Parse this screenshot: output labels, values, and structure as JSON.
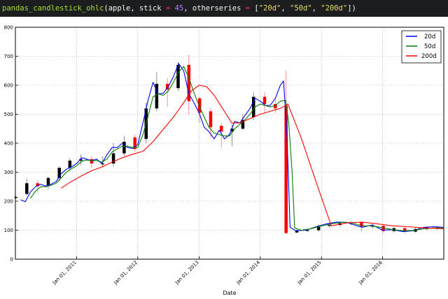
{
  "code": {
    "fn": "pandas_candlestick_ohlc",
    "open": "(",
    "arg1": "apple, stick ",
    "eq1": "=",
    "sp1": " ",
    "stick": "45",
    "sep1": ", otherseries ",
    "eq2": "=",
    "lb": " [",
    "s1": "\"20d\"",
    "c1": ", ",
    "s2": "\"50d\"",
    "c2": ", ",
    "s3": "\"200d\"",
    "close": "])"
  },
  "chart_data": {
    "type": "line",
    "xlabel": "Date",
    "ylabel": "",
    "ylim": [
      0,
      800
    ],
    "xlim": [
      "2010-01-01",
      "2016-12-31"
    ],
    "yticks": [
      0,
      100,
      200,
      300,
      400,
      500,
      600,
      700,
      800
    ],
    "xticks": [
      {
        "date": "2011-01-01",
        "label": "Jan 01, 2011"
      },
      {
        "date": "2012-01-01",
        "label": "Jan 01, 2012"
      },
      {
        "date": "2013-01-01",
        "label": "Jan 01, 2013"
      },
      {
        "date": "2014-01-01",
        "label": "Jan 01, 2014"
      },
      {
        "date": "2015-01-01",
        "label": "Jan 01, 2015"
      },
      {
        "date": "2016-01-01",
        "label": "Jan 01, 2016"
      }
    ],
    "grid": true,
    "legend": "top-right",
    "candle_colors": {
      "up": "#000000",
      "down": "#ff0000"
    },
    "candles": [
      {
        "date": "2010-01-04",
        "open": 212,
        "high": 220,
        "low": 208,
        "close": 214
      },
      {
        "date": "2010-03-10",
        "open": 225,
        "high": 278,
        "low": 220,
        "close": 262
      },
      {
        "date": "2010-05-14",
        "open": 262,
        "high": 272,
        "low": 230,
        "close": 252
      },
      {
        "date": "2010-07-16",
        "open": 252,
        "high": 285,
        "low": 240,
        "close": 280
      },
      {
        "date": "2010-09-20",
        "open": 280,
        "high": 320,
        "low": 270,
        "close": 315
      },
      {
        "date": "2010-11-22",
        "open": 315,
        "high": 348,
        "low": 305,
        "close": 340
      },
      {
        "date": "2011-01-26",
        "open": 340,
        "high": 362,
        "low": 325,
        "close": 345
      },
      {
        "date": "2011-04-01",
        "open": 345,
        "high": 355,
        "low": 315,
        "close": 330
      },
      {
        "date": "2011-06-06",
        "open": 330,
        "high": 355,
        "low": 315,
        "close": 330
      },
      {
        "date": "2011-08-09",
        "open": 330,
        "high": 400,
        "low": 320,
        "close": 365
      },
      {
        "date": "2011-10-12",
        "open": 365,
        "high": 425,
        "low": 355,
        "close": 405
      },
      {
        "date": "2011-12-15",
        "open": 420,
        "high": 430,
        "low": 370,
        "close": 380
      },
      {
        "date": "2012-02-20",
        "open": 415,
        "high": 540,
        "low": 400,
        "close": 520
      },
      {
        "date": "2012-04-23",
        "open": 520,
        "high": 645,
        "low": 510,
        "close": 605
      },
      {
        "date": "2012-06-26",
        "open": 605,
        "high": 625,
        "low": 525,
        "close": 585
      },
      {
        "date": "2012-08-29",
        "open": 590,
        "high": 680,
        "low": 580,
        "close": 670
      },
      {
        "date": "2012-11-01",
        "open": 670,
        "high": 705,
        "low": 500,
        "close": 545
      },
      {
        "date": "2013-01-04",
        "open": 555,
        "high": 560,
        "low": 470,
        "close": 505
      },
      {
        "date": "2013-03-11",
        "open": 510,
        "high": 520,
        "low": 420,
        "close": 455
      },
      {
        "date": "2013-05-14",
        "open": 460,
        "high": 470,
        "low": 385,
        "close": 440
      },
      {
        "date": "2013-07-17",
        "open": 440,
        "high": 465,
        "low": 390,
        "close": 450
      },
      {
        "date": "2013-09-19",
        "open": 450,
        "high": 500,
        "low": 445,
        "close": 480
      },
      {
        "date": "2013-11-22",
        "open": 490,
        "high": 575,
        "low": 480,
        "close": 560
      },
      {
        "date": "2014-01-27",
        "open": 560,
        "high": 575,
        "low": 505,
        "close": 535
      },
      {
        "date": "2014-04-01",
        "open": 535,
        "high": 550,
        "low": 505,
        "close": 520
      },
      {
        "date": "2014-06-04",
        "open": 530,
        "high": 650,
        "low": 88,
        "close": 90
      },
      {
        "date": "2014-08-07",
        "open": 92,
        "high": 102,
        "low": 90,
        "close": 100
      },
      {
        "date": "2014-10-10",
        "open": 100,
        "high": 102,
        "low": 96,
        "close": 100
      },
      {
        "date": "2014-12-15",
        "open": 100,
        "high": 120,
        "low": 95,
        "close": 115
      },
      {
        "date": "2015-02-17",
        "open": 115,
        "high": 125,
        "low": 108,
        "close": 118
      },
      {
        "date": "2015-04-22",
        "open": 118,
        "high": 130,
        "low": 112,
        "close": 124
      },
      {
        "date": "2015-06-25",
        "open": 124,
        "high": 132,
        "low": 118,
        "close": 127
      },
      {
        "date": "2015-08-28",
        "open": 127,
        "high": 130,
        "low": 95,
        "close": 112
      },
      {
        "date": "2015-11-02",
        "open": 112,
        "high": 122,
        "low": 105,
        "close": 115
      },
      {
        "date": "2016-01-05",
        "open": 115,
        "high": 118,
        "low": 92,
        "close": 97
      },
      {
        "date": "2016-03-09",
        "open": 97,
        "high": 110,
        "low": 92,
        "close": 107
      },
      {
        "date": "2016-05-12",
        "open": 107,
        "high": 112,
        "low": 90,
        "close": 95
      },
      {
        "date": "2016-07-15",
        "open": 95,
        "high": 110,
        "low": 92,
        "close": 104
      },
      {
        "date": "2016-09-19",
        "open": 104,
        "high": 112,
        "low": 100,
        "close": 110
      },
      {
        "date": "2016-11-22",
        "open": 110,
        "high": 115,
        "low": 100,
        "close": 108
      }
    ],
    "series": [
      {
        "name": "20d",
        "color": "#0000ff",
        "points": [
          [
            "2010-02-01",
            205
          ],
          [
            "2010-03-01",
            198
          ],
          [
            "2010-04-01",
            232
          ],
          [
            "2010-05-01",
            250
          ],
          [
            "2010-06-01",
            258
          ],
          [
            "2010-07-01",
            252
          ],
          [
            "2010-08-01",
            258
          ],
          [
            "2010-09-01",
            268
          ],
          [
            "2010-10-01",
            295
          ],
          [
            "2010-11-01",
            310
          ],
          [
            "2010-12-01",
            318
          ],
          [
            "2011-01-01",
            330
          ],
          [
            "2011-02-01",
            350
          ],
          [
            "2011-03-01",
            345
          ],
          [
            "2011-04-01",
            340
          ],
          [
            "2011-05-01",
            345
          ],
          [
            "2011-06-01",
            330
          ],
          [
            "2011-07-01",
            360
          ],
          [
            "2011-08-01",
            385
          ],
          [
            "2011-09-01",
            385
          ],
          [
            "2011-10-01",
            400
          ],
          [
            "2011-11-01",
            385
          ],
          [
            "2011-12-01",
            382
          ],
          [
            "2012-01-01",
            395
          ],
          [
            "2012-02-01",
            470
          ],
          [
            "2012-03-01",
            545
          ],
          [
            "2012-04-01",
            610
          ],
          [
            "2012-05-01",
            570
          ],
          [
            "2012-06-01",
            572
          ],
          [
            "2012-07-01",
            595
          ],
          [
            "2012-08-01",
            630
          ],
          [
            "2012-09-01",
            675
          ],
          [
            "2012-10-01",
            650
          ],
          [
            "2012-11-01",
            570
          ],
          [
            "2012-12-01",
            540
          ],
          [
            "2013-01-01",
            505
          ],
          [
            "2013-02-01",
            455
          ],
          [
            "2013-03-01",
            440
          ],
          [
            "2013-04-01",
            415
          ],
          [
            "2013-05-01",
            445
          ],
          [
            "2013-06-01",
            415
          ],
          [
            "2013-07-01",
            430
          ],
          [
            "2013-08-01",
            475
          ],
          [
            "2013-09-01",
            470
          ],
          [
            "2013-10-01",
            495
          ],
          [
            "2013-11-01",
            520
          ],
          [
            "2013-12-01",
            555
          ],
          [
            "2014-01-01",
            545
          ],
          [
            "2014-02-01",
            530
          ],
          [
            "2014-03-01",
            530
          ],
          [
            "2014-04-01",
            555
          ],
          [
            "2014-05-01",
            600
          ],
          [
            "2014-05-20",
            615
          ],
          [
            "2014-06-10",
            420
          ],
          [
            "2014-06-28",
            110
          ],
          [
            "2014-08-01",
            98
          ],
          [
            "2014-10-01",
            100
          ],
          [
            "2014-12-01",
            112
          ],
          [
            "2015-02-01",
            122
          ],
          [
            "2015-04-01",
            128
          ],
          [
            "2015-06-01",
            127
          ],
          [
            "2015-08-01",
            115
          ],
          [
            "2015-09-01",
            110
          ],
          [
            "2015-11-01",
            118
          ],
          [
            "2016-01-01",
            100
          ],
          [
            "2016-03-01",
            102
          ],
          [
            "2016-05-01",
            95
          ],
          [
            "2016-07-01",
            98
          ],
          [
            "2016-09-01",
            110
          ],
          [
            "2016-11-01",
            112
          ],
          [
            "2016-12-31",
            110
          ]
        ]
      },
      {
        "name": "50d",
        "color": "#008000",
        "points": [
          [
            "2010-04-01",
            210
          ],
          [
            "2010-05-01",
            235
          ],
          [
            "2010-06-01",
            250
          ],
          [
            "2010-07-01",
            250
          ],
          [
            "2010-08-01",
            255
          ],
          [
            "2010-09-01",
            262
          ],
          [
            "2010-10-01",
            280
          ],
          [
            "2010-11-01",
            300
          ],
          [
            "2010-12-01",
            312
          ],
          [
            "2011-01-01",
            322
          ],
          [
            "2011-02-01",
            338
          ],
          [
            "2011-03-01",
            342
          ],
          [
            "2011-04-01",
            340
          ],
          [
            "2011-05-01",
            340
          ],
          [
            "2011-06-01",
            335
          ],
          [
            "2011-07-01",
            345
          ],
          [
            "2011-08-01",
            370
          ],
          [
            "2011-09-01",
            380
          ],
          [
            "2011-10-01",
            390
          ],
          [
            "2011-11-01",
            390
          ],
          [
            "2011-12-01",
            385
          ],
          [
            "2012-01-01",
            385
          ],
          [
            "2012-02-01",
            430
          ],
          [
            "2012-03-01",
            490
          ],
          [
            "2012-04-01",
            560
          ],
          [
            "2012-05-01",
            570
          ],
          [
            "2012-06-01",
            565
          ],
          [
            "2012-07-01",
            580
          ],
          [
            "2012-08-01",
            610
          ],
          [
            "2012-09-01",
            645
          ],
          [
            "2012-10-01",
            665
          ],
          [
            "2012-11-01",
            625
          ],
          [
            "2012-12-01",
            575
          ],
          [
            "2013-01-01",
            530
          ],
          [
            "2013-02-01",
            490
          ],
          [
            "2013-03-01",
            455
          ],
          [
            "2013-04-01",
            435
          ],
          [
            "2013-05-01",
            430
          ],
          [
            "2013-06-01",
            425
          ],
          [
            "2013-07-01",
            425
          ],
          [
            "2013-08-01",
            450
          ],
          [
            "2013-09-01",
            465
          ],
          [
            "2013-10-01",
            480
          ],
          [
            "2013-11-01",
            500
          ],
          [
            "2013-12-01",
            525
          ],
          [
            "2014-01-01",
            535
          ],
          [
            "2014-02-01",
            530
          ],
          [
            "2014-03-01",
            525
          ],
          [
            "2014-04-01",
            530
          ],
          [
            "2014-05-01",
            545
          ],
          [
            "2014-06-01",
            548
          ],
          [
            "2014-06-20",
            470
          ],
          [
            "2014-07-10",
            300
          ],
          [
            "2014-07-25",
            108
          ],
          [
            "2014-09-01",
            100
          ],
          [
            "2014-11-01",
            105
          ],
          [
            "2015-01-01",
            115
          ],
          [
            "2015-03-01",
            122
          ],
          [
            "2015-05-01",
            127
          ],
          [
            "2015-07-01",
            125
          ],
          [
            "2015-09-01",
            115
          ],
          [
            "2015-11-01",
            115
          ],
          [
            "2016-01-01",
            108
          ],
          [
            "2016-03-01",
            102
          ],
          [
            "2016-05-01",
            98
          ],
          [
            "2016-07-01",
            99
          ],
          [
            "2016-09-01",
            105
          ],
          [
            "2016-11-01",
            108
          ],
          [
            "2016-12-31",
            108
          ]
        ]
      },
      {
        "name": "200d",
        "color": "#ff0000",
        "points": [
          [
            "2010-10-01",
            245
          ],
          [
            "2010-12-01",
            268
          ],
          [
            "2011-02-01",
            288
          ],
          [
            "2011-04-01",
            305
          ],
          [
            "2011-06-01",
            318
          ],
          [
            "2011-08-01",
            335
          ],
          [
            "2011-10-01",
            350
          ],
          [
            "2011-12-01",
            362
          ],
          [
            "2012-02-01",
            372
          ],
          [
            "2012-04-01",
            405
          ],
          [
            "2012-06-01",
            448
          ],
          [
            "2012-08-01",
            490
          ],
          [
            "2012-10-01",
            540
          ],
          [
            "2012-11-15",
            580
          ],
          [
            "2013-01-01",
            600
          ],
          [
            "2013-02-15",
            595
          ],
          [
            "2013-04-01",
            565
          ],
          [
            "2013-06-01",
            510
          ],
          [
            "2013-07-15",
            470
          ],
          [
            "2013-09-01",
            470
          ],
          [
            "2013-11-01",
            485
          ],
          [
            "2014-01-01",
            500
          ],
          [
            "2014-03-01",
            510
          ],
          [
            "2014-05-01",
            520
          ],
          [
            "2014-06-15",
            535
          ],
          [
            "2014-09-01",
            420
          ],
          [
            "2014-12-01",
            265
          ],
          [
            "2015-03-01",
            115
          ],
          [
            "2015-06-01",
            125
          ],
          [
            "2015-09-01",
            128
          ],
          [
            "2015-12-01",
            122
          ],
          [
            "2016-03-01",
            115
          ],
          [
            "2016-06-01",
            112
          ],
          [
            "2016-09-01",
            108
          ],
          [
            "2016-12-31",
            105
          ]
        ]
      }
    ]
  }
}
